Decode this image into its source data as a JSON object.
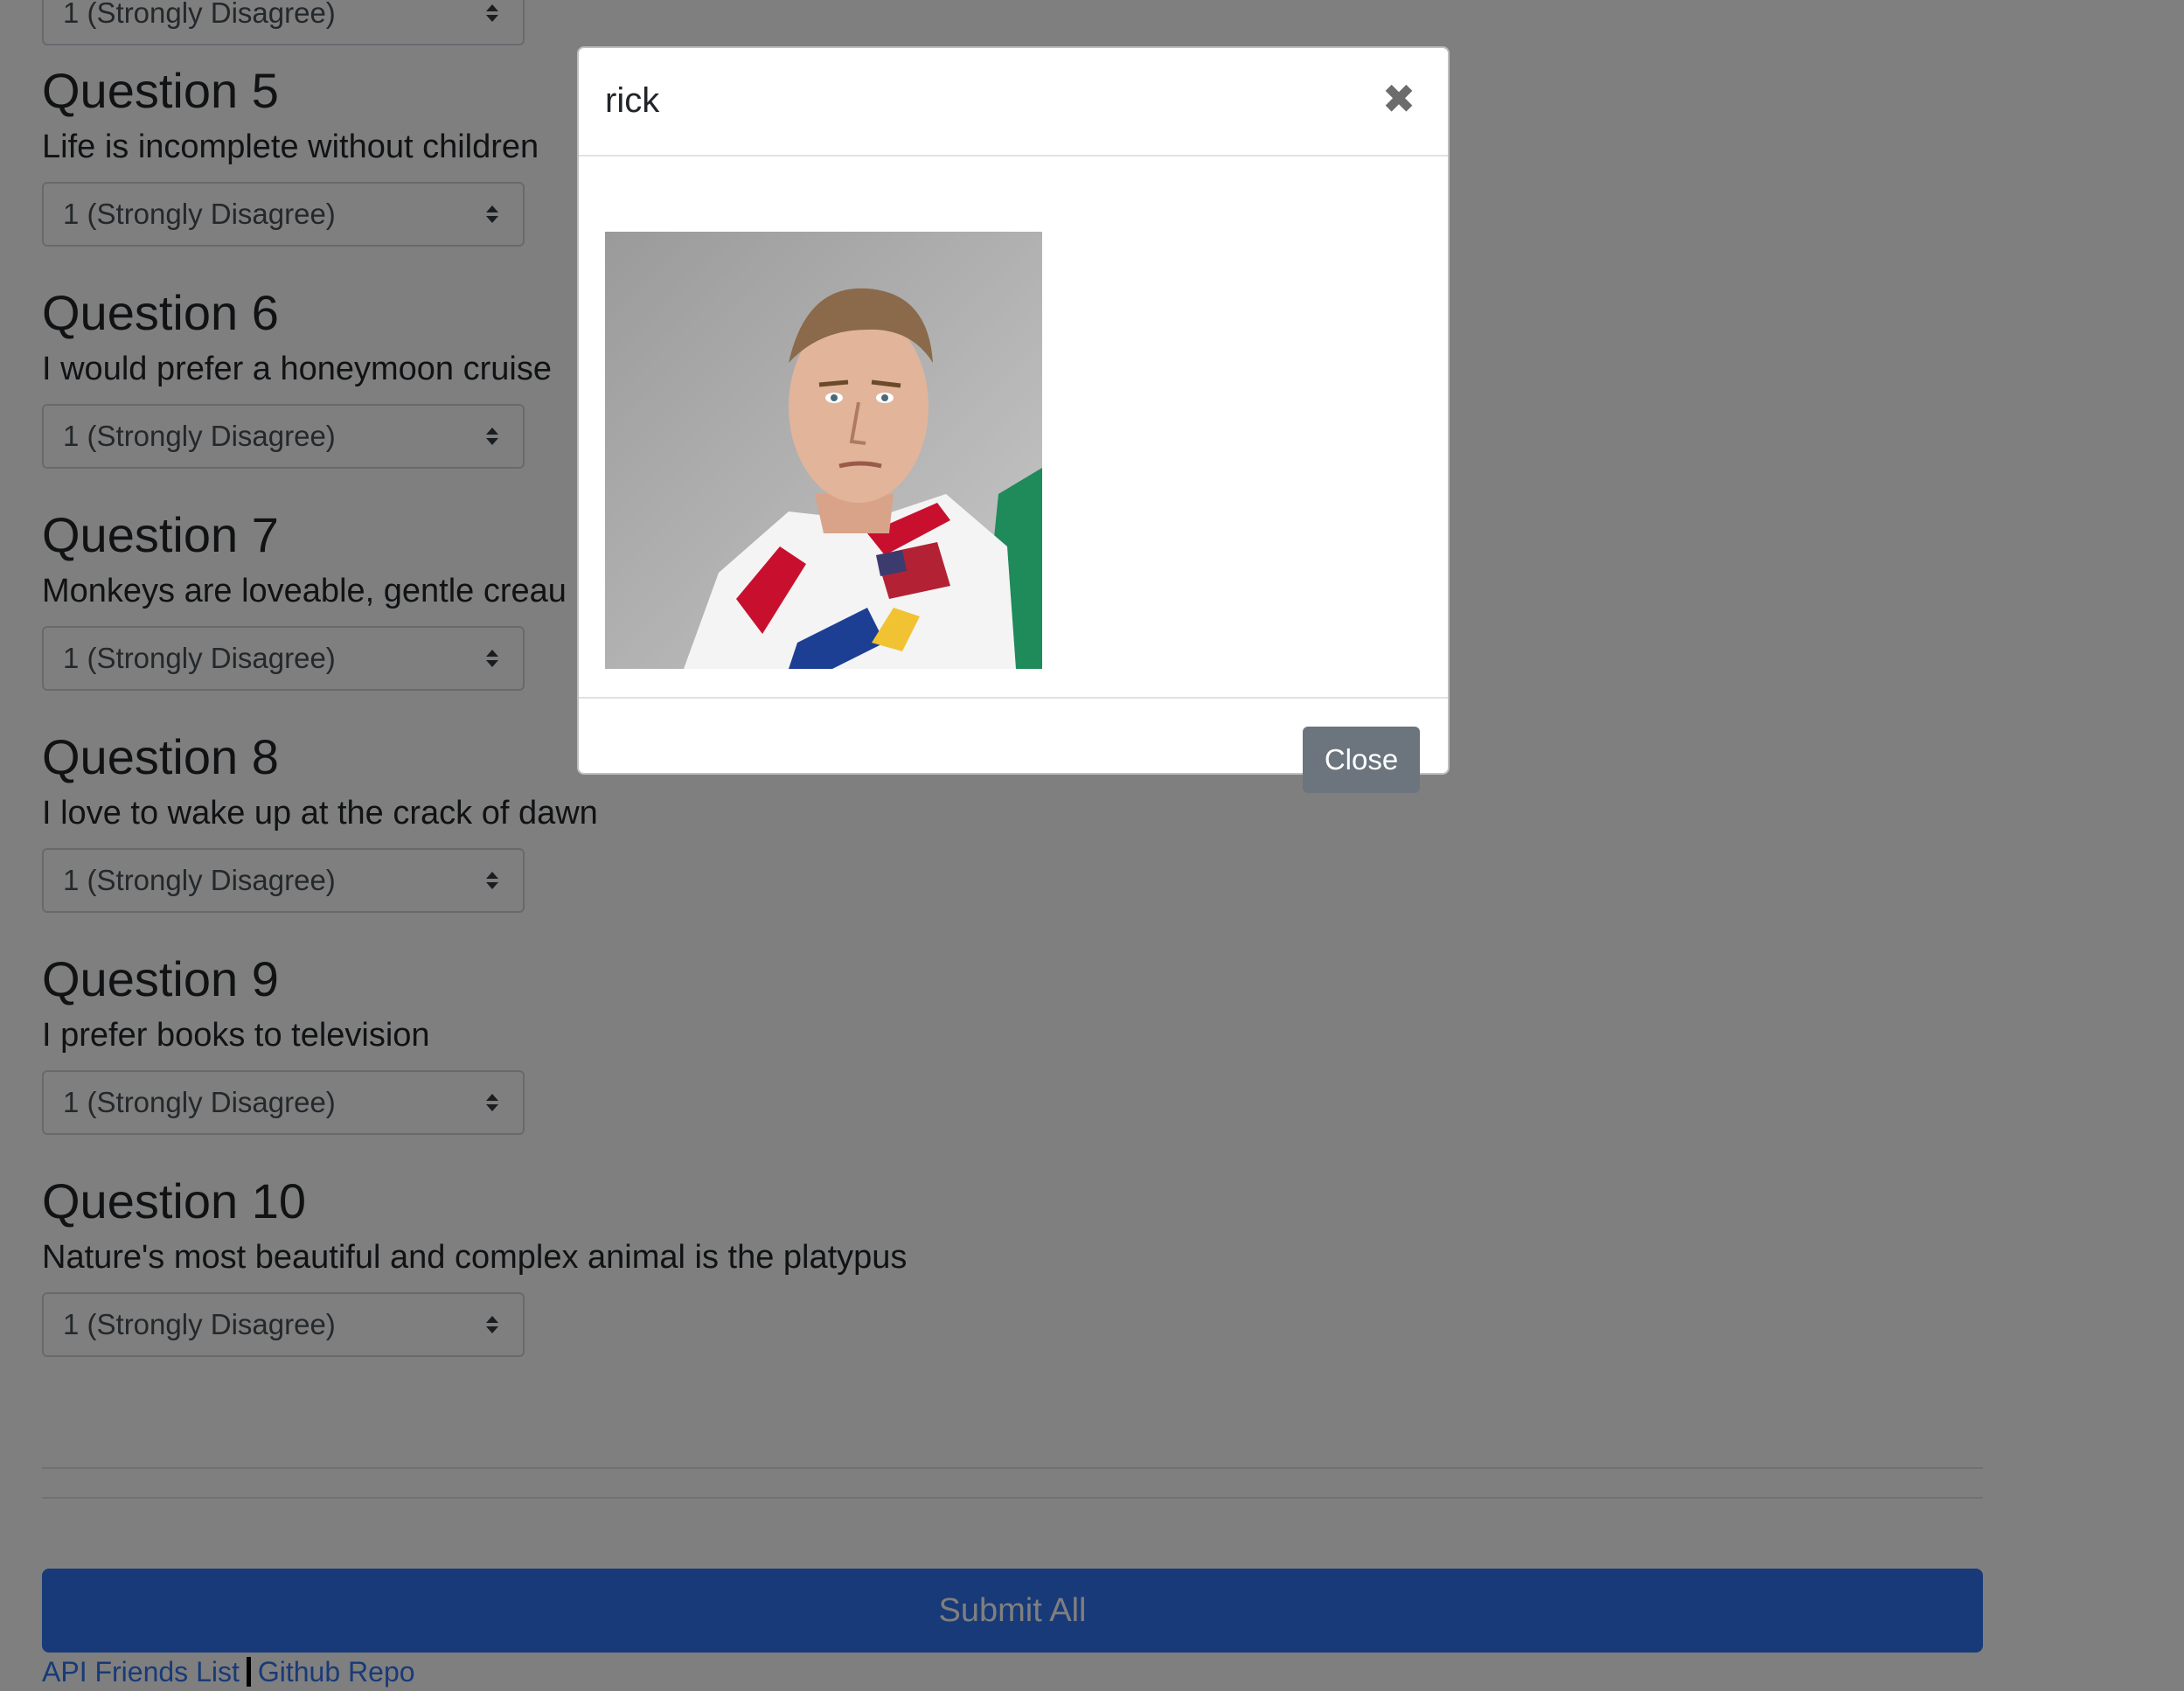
{
  "questions": [
    {
      "title": "Question 5",
      "text": "Life is incomplete without children",
      "selected": "1 (Strongly Disagree)"
    },
    {
      "title": "Question 6",
      "text": "I would prefer a honeymoon cruise",
      "selected": "1 (Strongly Disagree)"
    },
    {
      "title": "Question 7",
      "text": "Monkeys are loveable, gentle creau",
      "selected": "1 (Strongly Disagree)"
    },
    {
      "title": "Question 8",
      "text": "I love to wake up at the crack of dawn",
      "selected": "1 (Strongly Disagree)"
    },
    {
      "title": "Question 9",
      "text": "I prefer books to television",
      "selected": "1 (Strongly Disagree)"
    },
    {
      "title": "Question 10",
      "text": "Nature's most beautiful and complex animal is the platypus",
      "selected": "1 (Strongly Disagree)"
    }
  ],
  "partial_select": {
    "selected": "1 (Strongly Disagree)"
  },
  "submit": {
    "label": "Submit All",
    "color": "#3074f0"
  },
  "footer": {
    "api_link": "API Friends List",
    "github_link": "Github Repo"
  },
  "modal": {
    "title": "rick",
    "close_icon": "close-icon",
    "close_button": "Close",
    "image_alt": "profile photo"
  },
  "colors": {
    "backdrop": "rgba(0,0,0,0.5)",
    "close_button": "#6c757d",
    "link": "#3074f0"
  }
}
